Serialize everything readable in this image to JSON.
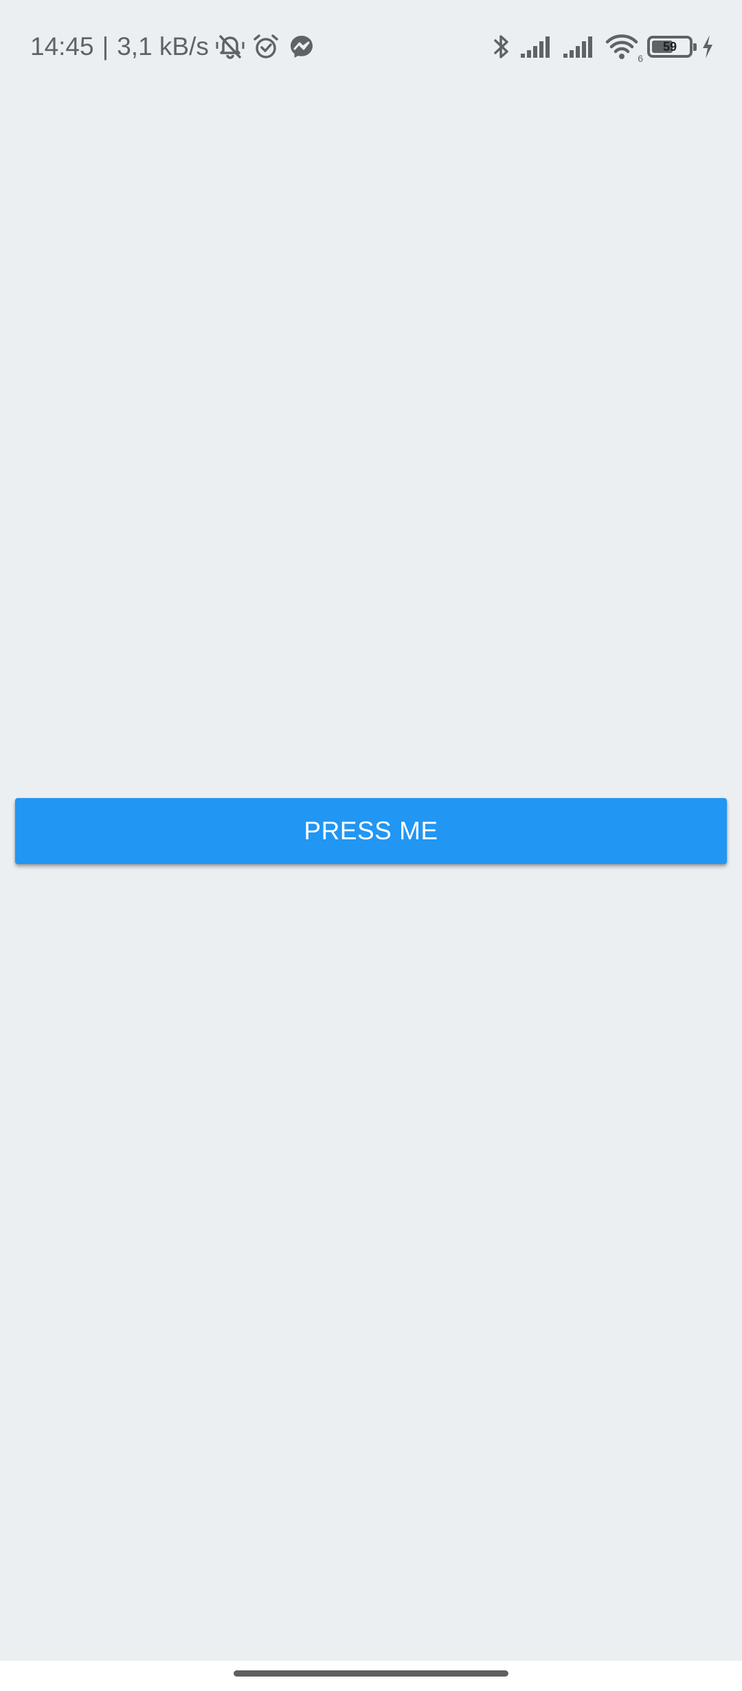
{
  "status_bar": {
    "time": "14:45",
    "separator": "|",
    "network_speed": "3,1 kB/s",
    "battery_level": "59",
    "left_icons": [
      "vibrate-off-icon",
      "alarm-icon",
      "messenger-icon"
    ],
    "right_icons": [
      "bluetooth-icon",
      "signal-icon",
      "signal-icon",
      "wifi-icon",
      "battery-icon",
      "charging-icon"
    ],
    "wifi_badge": "6"
  },
  "main": {
    "button_label": "PRESS ME",
    "button_color": "#2196f3"
  },
  "background_color": "#eceff1"
}
